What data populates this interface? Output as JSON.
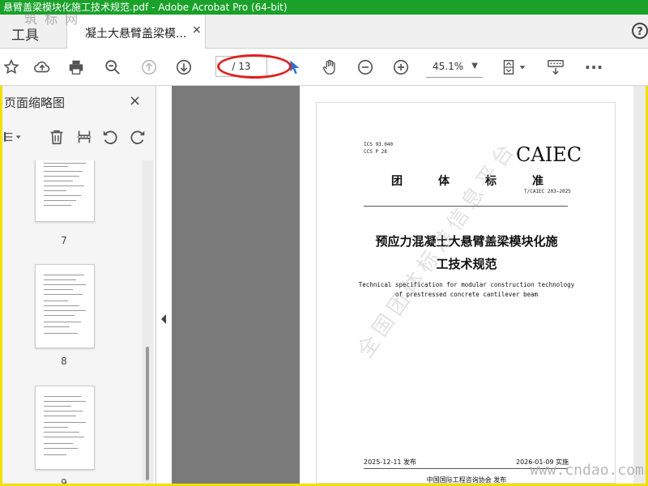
{
  "window": {
    "title": "悬臂盖梁模块化施工技术规范.pdf - Adobe Acrobat Pro (64-bit)"
  },
  "tabs": {
    "tools_label": "工具",
    "doc_tab_label": "凝土大悬臂盖梁模...",
    "close_glyph": "×",
    "help_glyph": "?"
  },
  "watermark_logo": "筑 标 网",
  "toolbar": {
    "page_indicator": "/ 13",
    "zoom_value": "45.1%",
    "zoom_caret": "▼",
    "more_glyph": "···"
  },
  "sidebar": {
    "title": "页面缩略图",
    "close_glyph": "×",
    "pages": [
      "7",
      "8",
      "9"
    ]
  },
  "document": {
    "ics_line": "ICS 93.040",
    "ccs_line": "CCS P 28",
    "org_mark": "CAIEC",
    "standard_type": [
      "团",
      "体",
      "标",
      "准"
    ],
    "standard_code": "T/CAIEC 203—2025",
    "title_cn_line1": "预应力混凝土大悬臂盖梁模块化施",
    "title_cn_line2": "工技术规范",
    "title_en_line1": "Technical specification for modular construction technology",
    "title_en_line2": "of prestressed concrete cantilever beam",
    "diagonal_watermark": "全国团体标准信息平台",
    "issue_date": "2025-12-11 发布",
    "effective_date": "2026-01-09 实施",
    "publisher": "中国国际工程咨询协会    发布"
  },
  "site_watermark": "www.cndao.com"
}
